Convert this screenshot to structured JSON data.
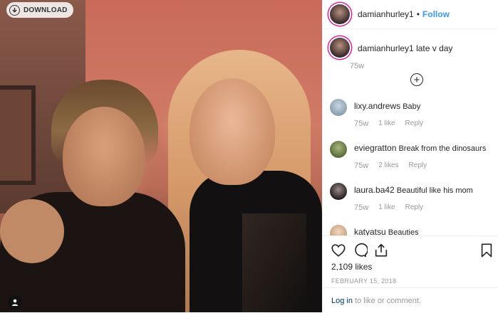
{
  "photo": {
    "download_label": "DOWNLOAD",
    "download_icon": "download-icon",
    "user_tag_icon": "user-tag-icon"
  },
  "header": {
    "username": "damianhurley1",
    "separator": "•",
    "follow_label": "Follow"
  },
  "caption": {
    "username": "damianhurley1",
    "text": "late v day",
    "time": "75w"
  },
  "load_more_icon": "plus-circle-icon",
  "comments": [
    {
      "username": "lixy.andrews",
      "text": "Baby",
      "time": "75w",
      "likes": "1 like",
      "reply": "Reply",
      "avatar_color": "#8aa0b0"
    },
    {
      "username": "eviegratton",
      "text": "Break from the dinosaurs",
      "time": "75w",
      "likes": "2 likes",
      "reply": "Reply",
      "avatar_color": "#7a8c5a"
    },
    {
      "username": "laura.ba42",
      "text": "Beautiful like his mom",
      "time": "75w",
      "likes": "1 like",
      "reply": "Reply",
      "avatar_color": "#4a3a3a"
    },
    {
      "username": "katyatsu",
      "text": "Beauties",
      "time": "",
      "likes": "",
      "reply": "",
      "avatar_color": "#d8b090"
    }
  ],
  "actions": {
    "like_icon": "heart-icon",
    "comment_icon": "comment-icon",
    "share_icon": "share-icon",
    "save_icon": "bookmark-icon",
    "likes_count": "2,109 likes",
    "date": "FEBRUARY 15, 2018"
  },
  "login": {
    "link": "Log in",
    "rest": " to like or comment."
  },
  "colors": {
    "link_blue": "#3897f0",
    "story_ring": "#d6249f",
    "muted": "#999999"
  }
}
